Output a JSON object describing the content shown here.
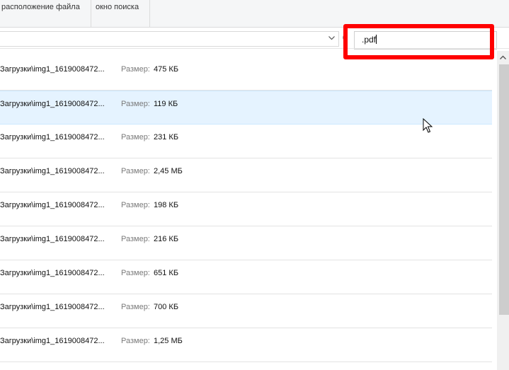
{
  "ribbon": {
    "location_label": "расположение файла",
    "search_window_label": "окно поиска"
  },
  "search": {
    "query": ".pdf"
  },
  "results": {
    "size_label": "Размер:",
    "items": [
      {
        "path": "Загрузки\\img1_1619008472...",
        "size": "475 КБ",
        "selected": false
      },
      {
        "path": "Загрузки\\img1_1619008472...",
        "size": "119 КБ",
        "selected": true
      },
      {
        "path": "Загрузки\\img1_1619008472...",
        "size": "231 КБ",
        "selected": false
      },
      {
        "path": "Загрузки\\img1_1619008472...",
        "size": "2,45 МБ",
        "selected": false
      },
      {
        "path": "Загрузки\\img1_1619008472...",
        "size": "198 КБ",
        "selected": false
      },
      {
        "path": "Загрузки\\img1_1619008472...",
        "size": "216 КБ",
        "selected": false
      },
      {
        "path": "Загрузки\\img1_1619008472...",
        "size": "651 КБ",
        "selected": false
      },
      {
        "path": "Загрузки\\img1_1619008472...",
        "size": "700 КБ",
        "selected": false
      },
      {
        "path": "Загрузки\\img1_1619008472...",
        "size": "1,25 МБ",
        "selected": false
      }
    ]
  },
  "colors": {
    "highlight_frame": "#ff0000",
    "selected_row": "#e5f3ff"
  },
  "icons": {
    "address_dropdown": "chevron-down-icon",
    "refresh": "refresh-icon",
    "scroll_up": "chevron-up-icon",
    "cursor": "mouse-cursor-icon"
  }
}
